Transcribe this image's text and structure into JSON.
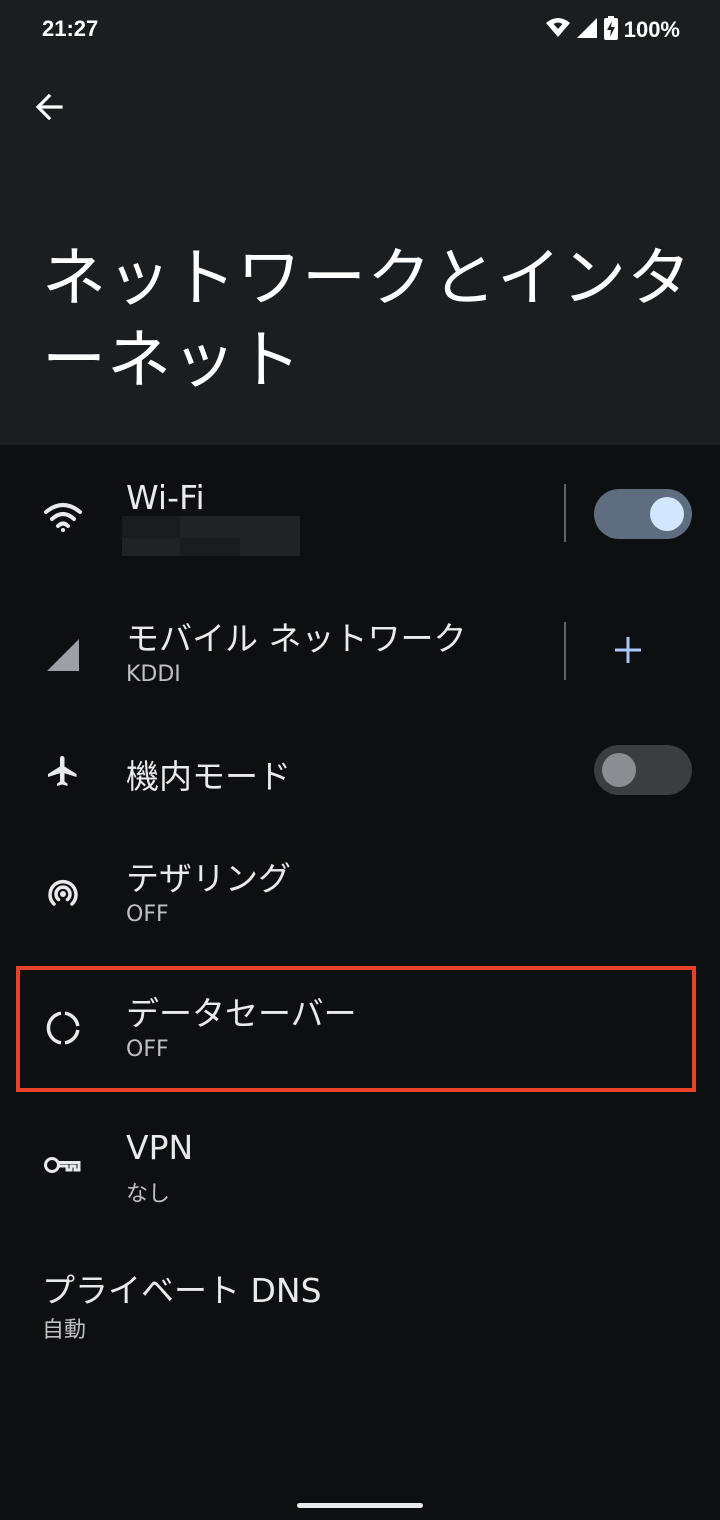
{
  "status_bar": {
    "time": "21:27",
    "battery": "100%",
    "icons": [
      "wifi-icon",
      "cell-signal-icon",
      "battery-charging-icon"
    ]
  },
  "header": {
    "back_icon": "arrow-back-icon",
    "title": "ネットワークとインターネット"
  },
  "items": {
    "wifi": {
      "title": "Wi-Fi",
      "icon": "wifi-icon",
      "toggle": "on"
    },
    "mobile": {
      "title": "モバイル ネットワーク",
      "subtitle": "KDDI",
      "icon": "cell-signal-icon",
      "action_icon": "add-icon"
    },
    "airplane": {
      "title": "機内モード",
      "icon": "airplane-icon",
      "toggle": "off"
    },
    "tethering": {
      "title": "テザリング",
      "subtitle": "OFF",
      "icon": "hotspot-icon"
    },
    "data_saver": {
      "title": "データセーバー",
      "subtitle": "OFF",
      "icon": "data-saver-icon"
    },
    "vpn": {
      "title": "VPN",
      "subtitle": "なし",
      "icon": "key-icon"
    },
    "private_dns": {
      "title": "プライベート DNS",
      "subtitle": "自動"
    }
  },
  "colors": {
    "background": "#0d0f11",
    "header": "#1b1e21",
    "highlight": "#e8432a",
    "toggle_on_track": "#5e6d7f",
    "toggle_on_thumb": "#d2e6ff",
    "accent": "#a8c7fa"
  }
}
